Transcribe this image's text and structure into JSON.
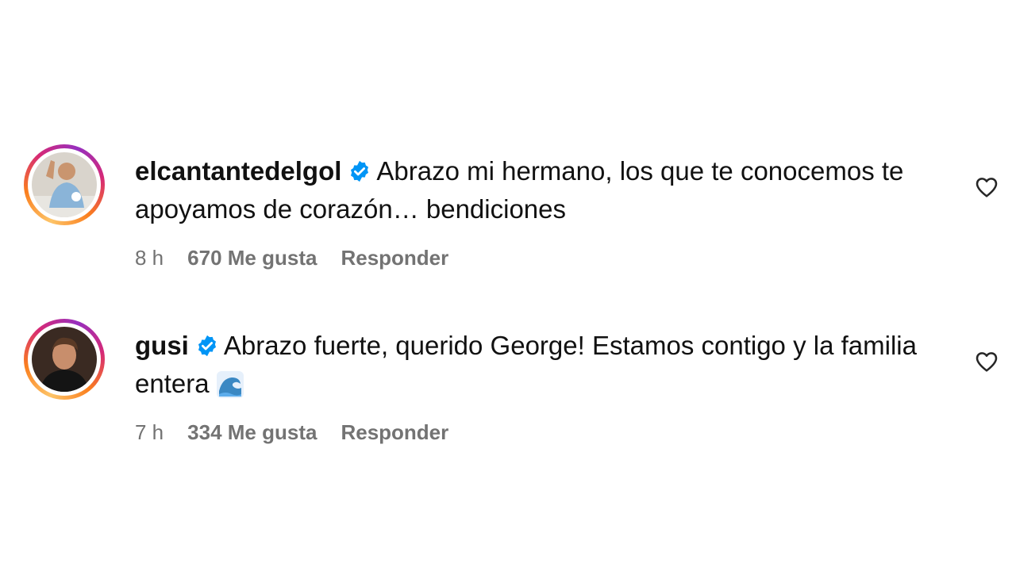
{
  "comments": [
    {
      "username": "elcantantedelgol",
      "verified": true,
      "text": "Abrazo mi hermano, los que te conocemos te apoyamos de corazón… bendiciones",
      "time": "8 h",
      "likes": "670 Me gusta",
      "reply": "Responder",
      "avatar_icon": "profile-photo",
      "like_icon": "heart-outline-icon"
    },
    {
      "username": "gusi",
      "verified": true,
      "text": "Abrazo fuerte, querido George! Estamos contigo y la familia entera",
      "emoji": "🌊",
      "time": "7 h",
      "likes": "334 Me gusta",
      "reply": "Responder",
      "avatar_icon": "profile-photo",
      "like_icon": "heart-outline-icon"
    }
  ],
  "colors": {
    "verified_blue": "#0095f6",
    "meta_gray": "#737373",
    "text": "#111111"
  }
}
